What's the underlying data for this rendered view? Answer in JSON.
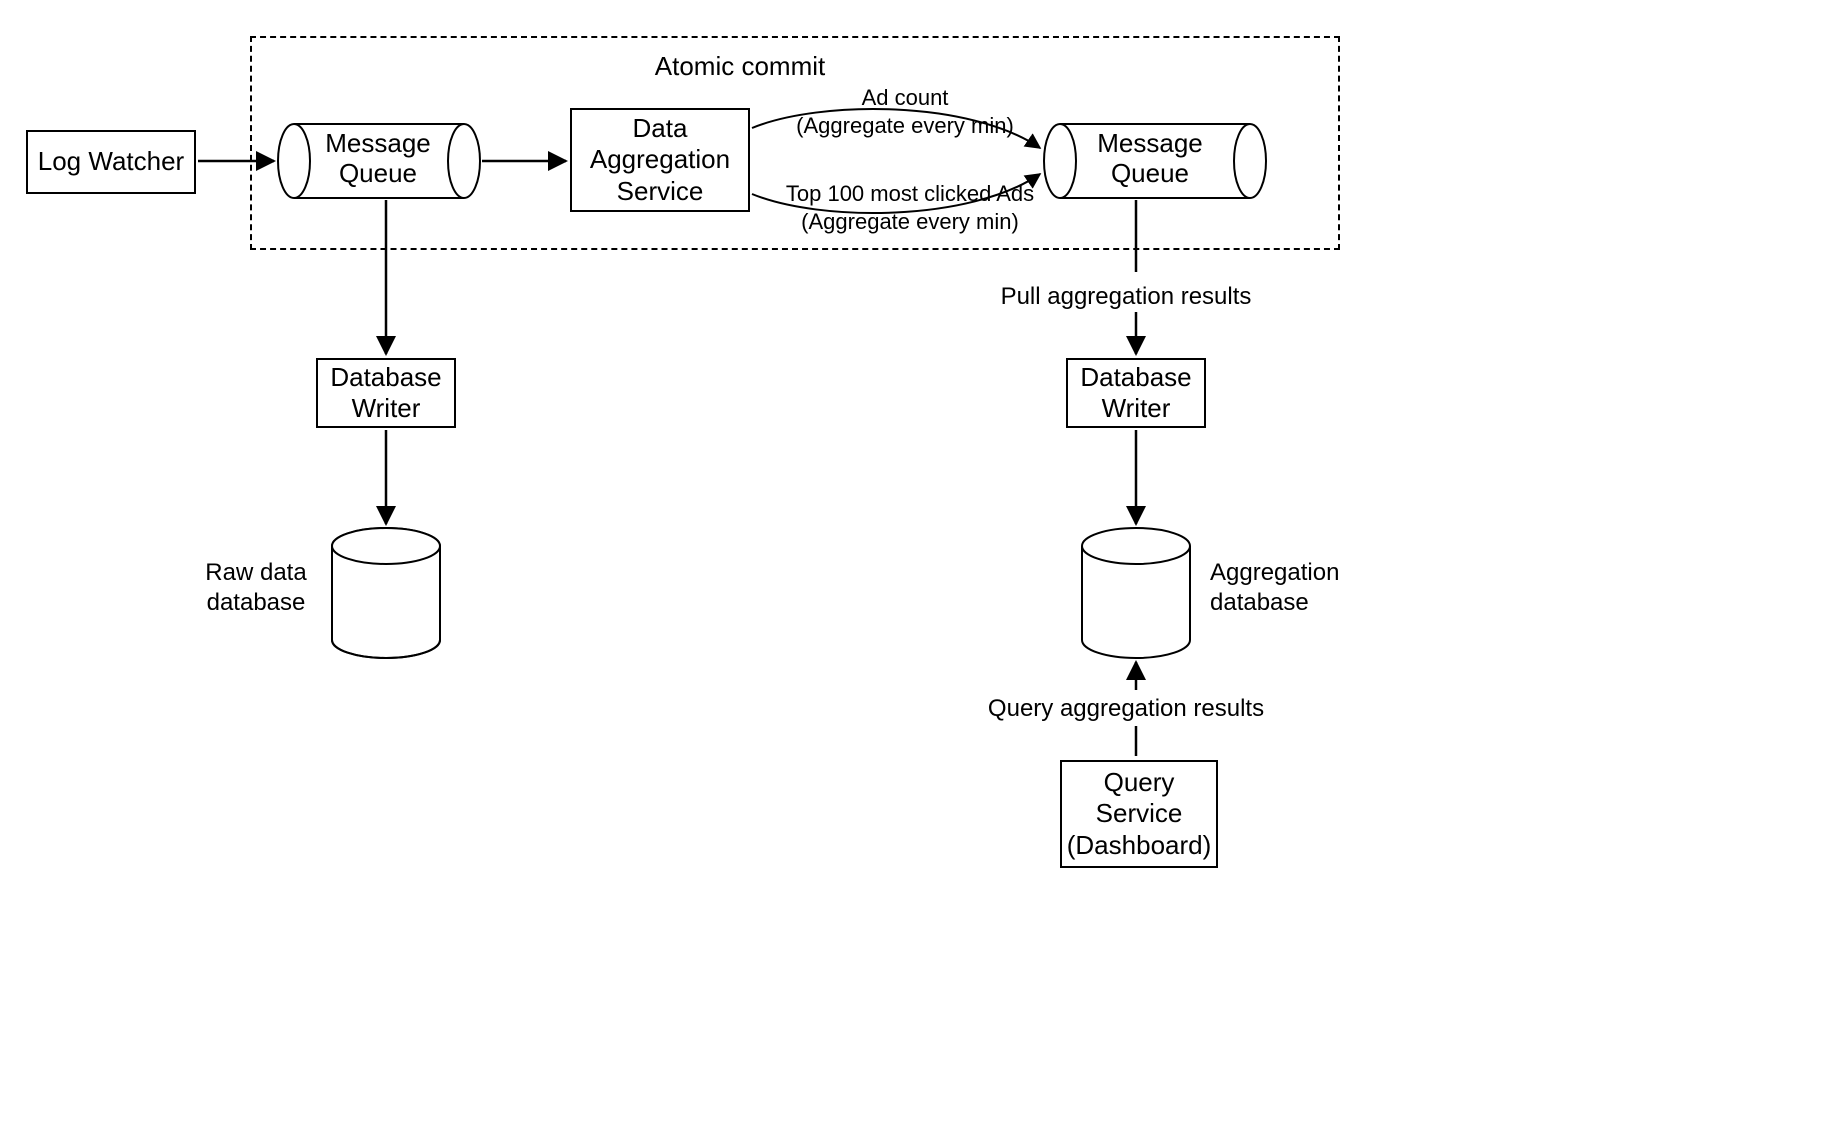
{
  "title": "Atomic commit",
  "nodes": {
    "log_watcher": "Log Watcher",
    "message_queue_1": "Message\nQueue",
    "data_aggregation_service": "Data\nAggregation\nService",
    "message_queue_2": "Message\nQueue",
    "database_writer_1": "Database\nWriter",
    "database_writer_2": "Database\nWriter",
    "raw_data_database": "Raw data\ndatabase",
    "aggregation_database": "Aggregation\ndatabase",
    "query_service": "Query\nService\n(Dashboard)"
  },
  "edges": {
    "ad_count": "Ad count\n(Aggregate every min)",
    "top_100": "Top 100 most clicked Ads\n(Aggregate every min)",
    "pull_results": "Pull aggregation results",
    "query_results": "Query aggregation results"
  }
}
